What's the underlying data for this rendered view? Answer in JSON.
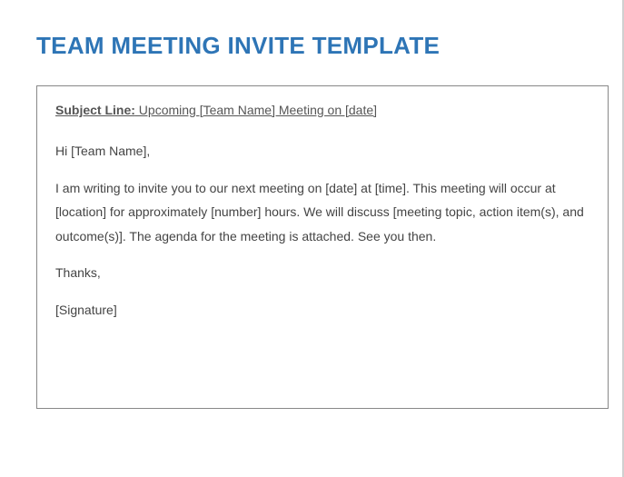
{
  "title": "TEAM MEETING INVITE TEMPLATE",
  "subject": {
    "label": "Subject Line:",
    "value": " Upcoming [Team Name] Meeting on [date]"
  },
  "body": {
    "greeting": "Hi [Team Name],",
    "main": "I am writing to invite you to our next meeting on [date] at [time]. This meeting will occur at [location] for approximately [number] hours. We will discuss [meeting topic, action item(s), and outcome(s)]. The agenda for the meeting is attached. See you then.",
    "thanks": "Thanks,",
    "signature": "[Signature]"
  }
}
